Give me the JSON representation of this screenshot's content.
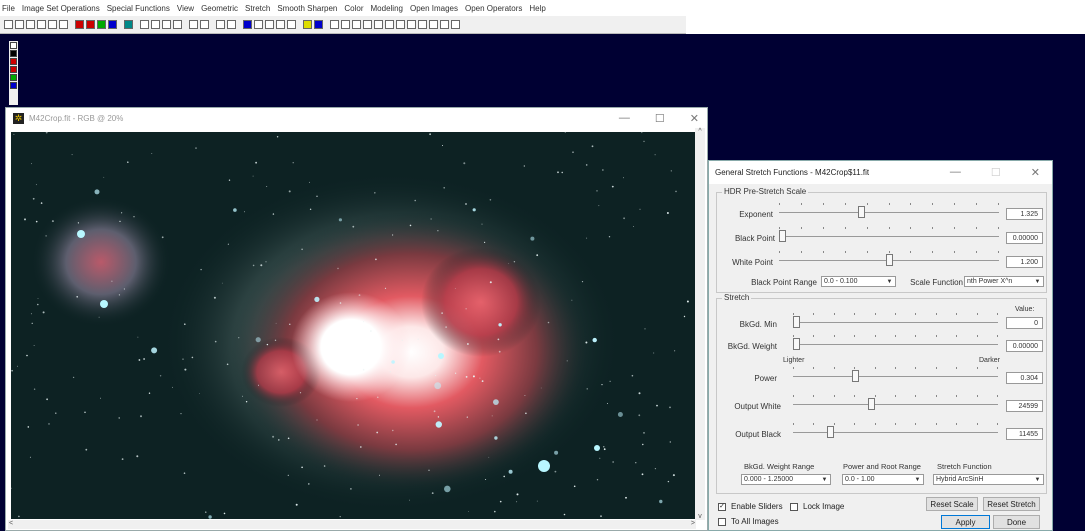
{
  "menu": [
    "File",
    "Image Set Operations",
    "Special Functions",
    "View",
    "Geometric",
    "Stretch",
    "Smooth Sharpen",
    "Color",
    "Modeling",
    "Open Images",
    "Open Operators",
    "Help"
  ],
  "image_window": {
    "title": "M42Crop.fit - RGB @ 20%"
  },
  "dialog": {
    "title": "General Stretch Functions - M42Crop$11.fit",
    "hdr_group": "HDR Pre-Stretch Scale",
    "exponent": {
      "label": "Exponent",
      "value": "1.325",
      "level": 0.37
    },
    "black_point": {
      "label": "Black Point",
      "value": "0.00000",
      "level": 0.0
    },
    "white_point": {
      "label": "White Point",
      "value": "1.200",
      "level": 0.5
    },
    "black_point_range": {
      "label": "Black Point Range",
      "value": "0.0 - 0.100"
    },
    "scale_function": {
      "label": "Scale Function",
      "value": "nth Power X^n"
    },
    "stretch_group": "Stretch",
    "value_header": "Value:",
    "bkgd_min": {
      "label": "BkGd. Min",
      "value": "0",
      "level": 0.0
    },
    "bkgd_weight": {
      "label": "BkGd. Weight",
      "value": "0.00000",
      "level": 0.0
    },
    "lighter": "Lighter",
    "darker": "Darker",
    "power": {
      "label": "Power",
      "value": "0.304",
      "level": 0.3
    },
    "output_white": {
      "label": "Output White",
      "value": "24599",
      "level": 0.38
    },
    "output_black": {
      "label": "Output Black",
      "value": "11455",
      "level": 0.17
    },
    "bkgd_weight_range": {
      "label": "BkGd. Weight Range",
      "value": "0.000 - 1.25000"
    },
    "power_root_range": {
      "label": "Power and Root Range",
      "value": "0.0 - 1.00"
    },
    "stretch_function": {
      "label": "Stretch Function",
      "value": "Hybrid ArcSinH"
    },
    "enable_sliders": {
      "label": "Enable Sliders",
      "checked": true
    },
    "lock_image": {
      "label": "Lock Image",
      "checked": false
    },
    "to_all_images": {
      "label": "To All Images",
      "checked": false
    },
    "reset_scale": "Reset Scale",
    "reset_stretch": "Reset Stretch",
    "apply": "Apply",
    "done": "Done"
  }
}
